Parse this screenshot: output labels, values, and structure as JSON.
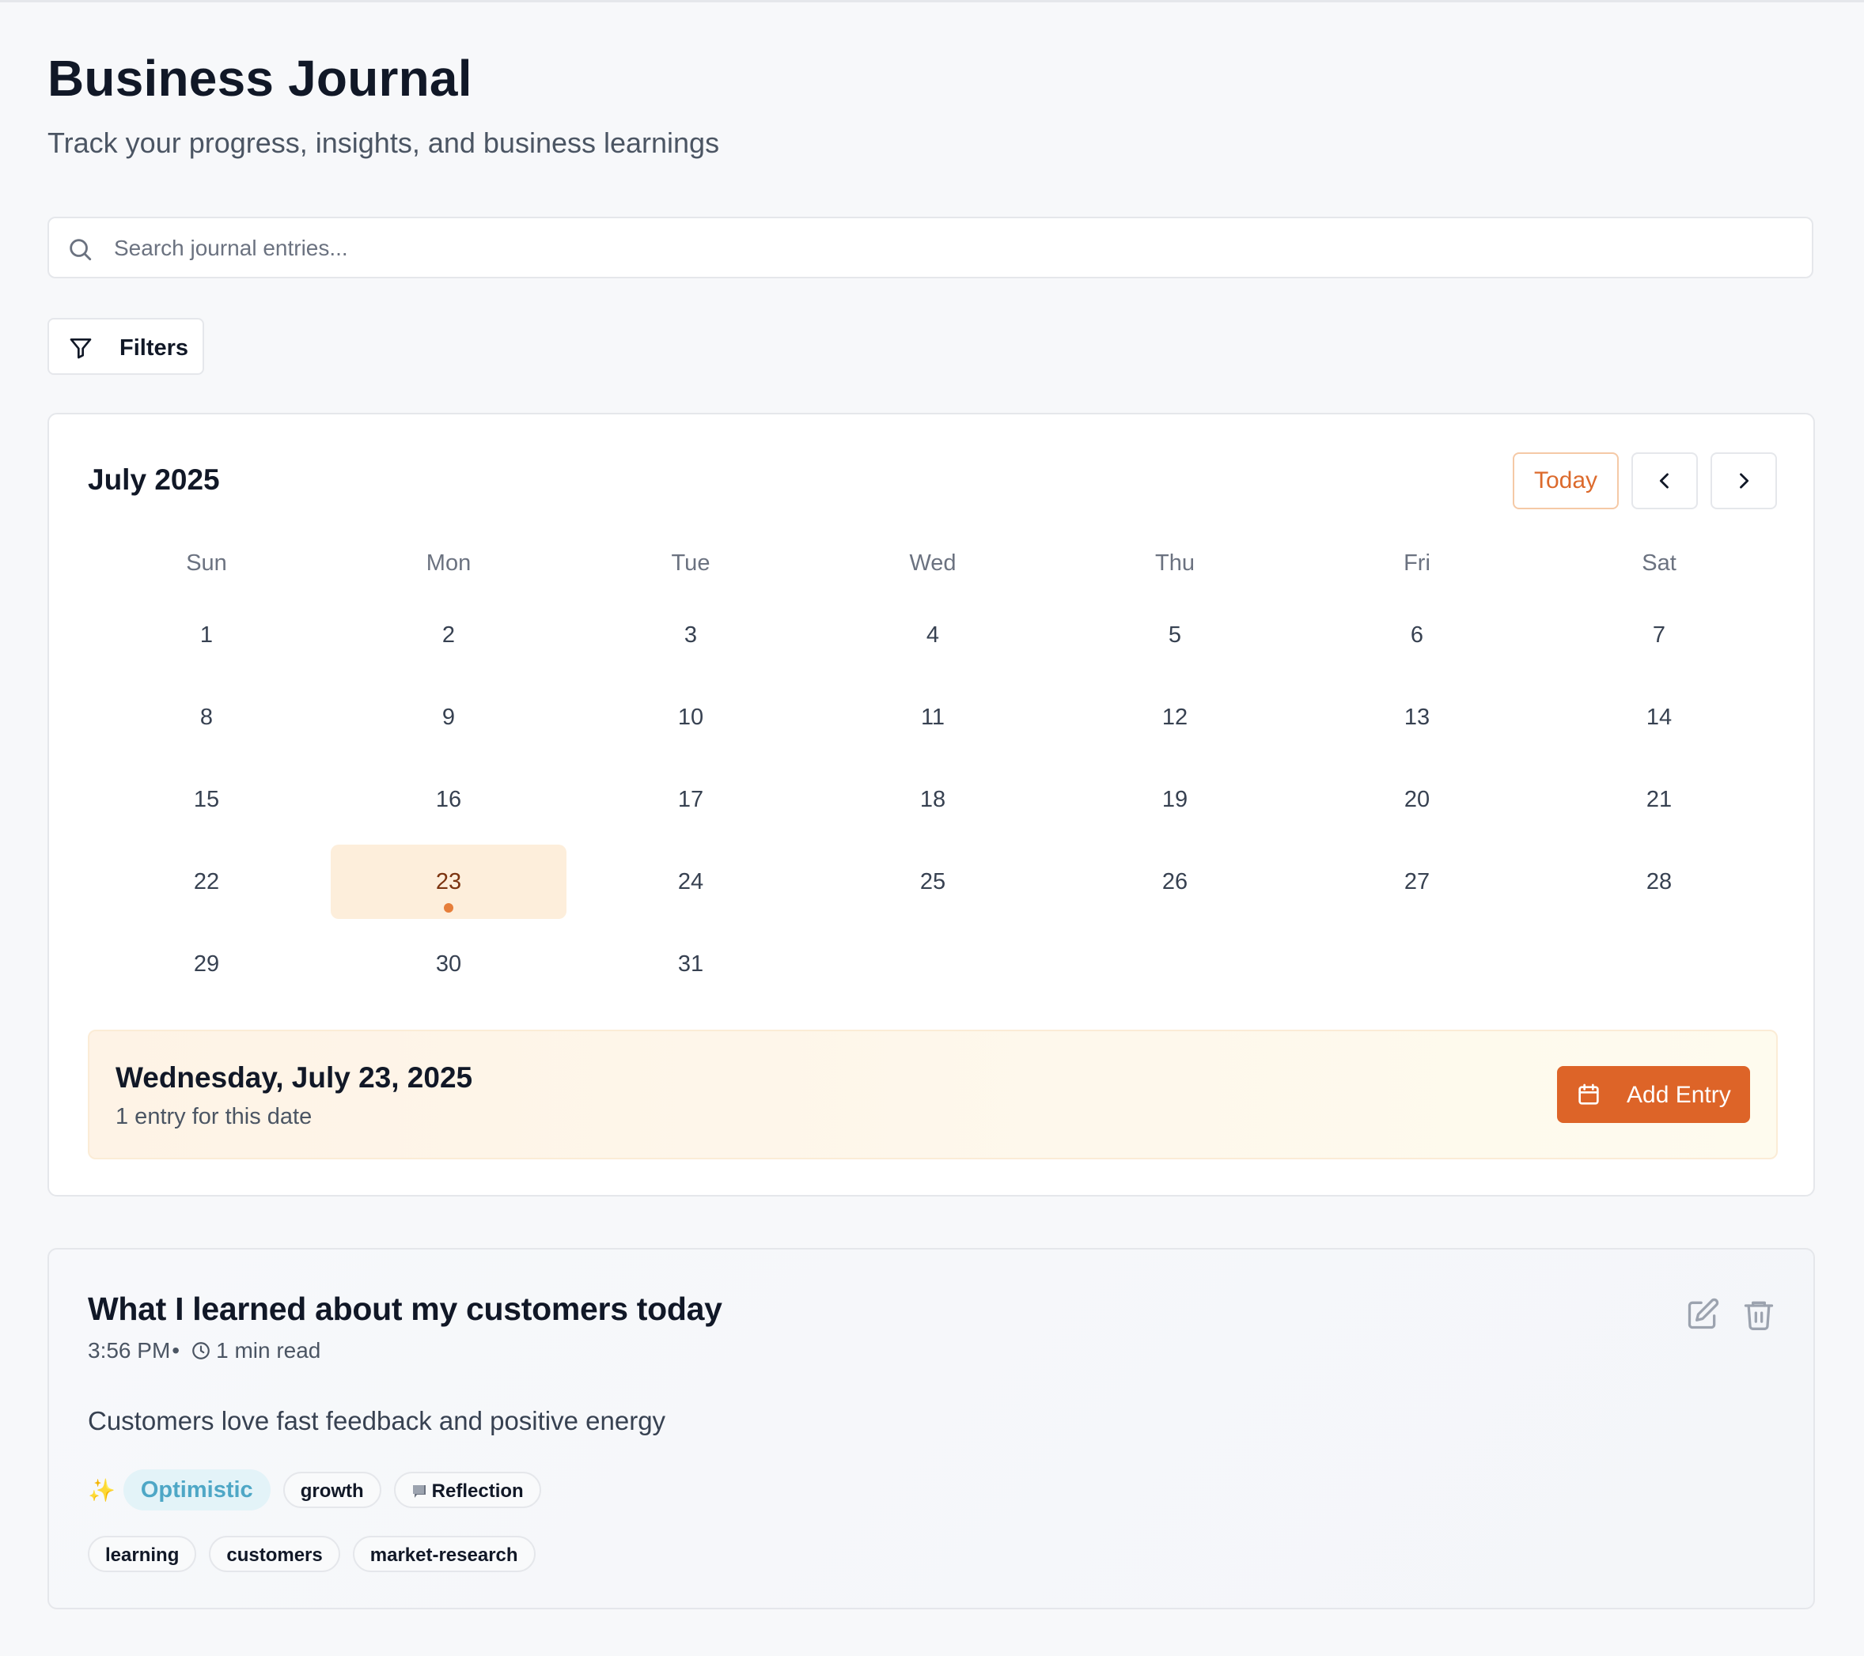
{
  "page": {
    "title": "Business Journal",
    "subtitle": "Track your progress, insights, and business learnings"
  },
  "search": {
    "placeholder": "Search journal entries...",
    "value": "",
    "icon": "search-icon"
  },
  "filters": {
    "label": "Filters",
    "icon": "filter-icon"
  },
  "calendar": {
    "month_label": "July 2025",
    "today_label": "Today",
    "prev_icon": "chevron-left-icon",
    "next_icon": "chevron-right-icon",
    "weekdays": [
      "Sun",
      "Mon",
      "Tue",
      "Wed",
      "Thu",
      "Fri",
      "Sat"
    ],
    "weeks": [
      [
        "1",
        "2",
        "3",
        "4",
        "5",
        "6",
        "7"
      ],
      [
        "8",
        "9",
        "10",
        "11",
        "12",
        "13",
        "14"
      ],
      [
        "15",
        "16",
        "17",
        "18",
        "19",
        "20",
        "21"
      ],
      [
        "22",
        "23",
        "24",
        "25",
        "26",
        "27",
        "28"
      ],
      [
        "29",
        "30",
        "31"
      ]
    ],
    "selected_day": "23",
    "days_with_entries": [
      "23"
    ],
    "accent_color": "#dd6428",
    "selected_bg": "#fdeedb"
  },
  "selected_date": {
    "date_label": "Wednesday, July 23, 2025",
    "count_label": "1 entry for this date",
    "add_label": "Add Entry",
    "add_icon": "calendar-icon"
  },
  "entries": [
    {
      "title": "What I learned about my customers today",
      "time": "3:56 PM",
      "separator": "•",
      "read_time": "1 min read",
      "body": "Customers love fast feedback and positive energy",
      "mood_icon": "sparkles-icon",
      "mood": "Optimistic",
      "category": "growth",
      "type": "Reflection",
      "type_icon": "flag-icon",
      "tags": [
        "learning",
        "customers",
        "market-research"
      ],
      "edit_icon": "edit-icon",
      "delete_icon": "trash-icon"
    }
  ]
}
